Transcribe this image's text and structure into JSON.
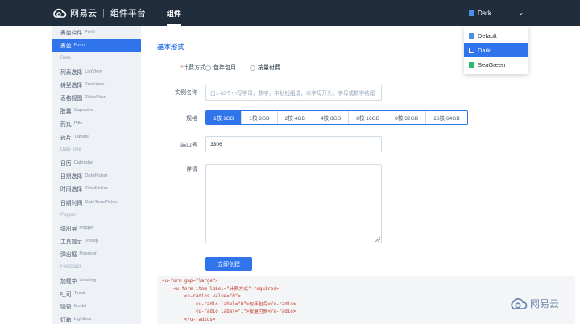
{
  "header": {
    "brand": "网易云",
    "platform": "组件平台",
    "nav_active": "组件",
    "theme_selected": "Dark",
    "theme_options": [
      {
        "label": "Default",
        "color": "#4a90e2"
      },
      {
        "label": "Dark",
        "color": "#ffffff"
      },
      {
        "label": "SeaGreen",
        "color": "#2bb673"
      }
    ]
  },
  "sidebar": {
    "items": [
      {
        "zh": "表单控件",
        "en": "Field"
      },
      {
        "zh": "表单",
        "en": "Form"
      },
      {
        "group": "Data"
      },
      {
        "zh": "列表选择",
        "en": "ListView"
      },
      {
        "zh": "树型选择",
        "en": "TreeView"
      },
      {
        "zh": "表格视图",
        "en": "TableView"
      },
      {
        "zh": "胶囊",
        "en": "Capsules"
      },
      {
        "zh": "药丸",
        "en": "Pills"
      },
      {
        "zh": "药片",
        "en": "Tablets"
      },
      {
        "group": "DateTime"
      },
      {
        "zh": "日历",
        "en": "Calendar"
      },
      {
        "zh": "日期选择",
        "en": "DatePicker"
      },
      {
        "zh": "时间选择",
        "en": "TimePicker"
      },
      {
        "zh": "日期时间",
        "en": "DateTimePicker"
      },
      {
        "group": "Popper"
      },
      {
        "zh": "弹出层",
        "en": "Popper"
      },
      {
        "zh": "工具提示",
        "en": "Tooltip"
      },
      {
        "zh": "弹出框",
        "en": "Popover"
      },
      {
        "group": "Feedback"
      },
      {
        "zh": "加载中",
        "en": "Loading"
      },
      {
        "zh": "吐司",
        "en": "Toast"
      },
      {
        "zh": "弹窗",
        "en": "Modal"
      },
      {
        "zh": "灯箱",
        "en": "Lightbox"
      }
    ]
  },
  "form": {
    "section_title": "基本形式",
    "billing_label": "计费方式",
    "billing_options": [
      "包年包月",
      "按量付费"
    ],
    "instance_label": "实例名称",
    "instance_placeholder": "由1-63个小写字母，数字，中划线组成，以字母开头，字母或数字结尾",
    "spec_label": "规格",
    "specs": [
      "1核 1GB",
      "1核 2GB",
      "2核 4GB",
      "4核 8GB",
      "8核 16GB",
      "8核 32GB",
      "16核 64GB"
    ],
    "port_label": "端口号",
    "port_value": "3306",
    "detail_label": "详情",
    "submit_label": "立即创建"
  },
  "code": {
    "lines": [
      "<u-form gap=\"large\">",
      "    <u-form-item label=\"计费方式\" required>",
      "        <u-radios value=\"0\">",
      "            <u-radio label=\"0\">包年包月</u-radio>",
      "            <u-radio label=\"1\">按量付费</u-radio>",
      "        </u-radios>"
    ]
  },
  "watermark": "网易云"
}
